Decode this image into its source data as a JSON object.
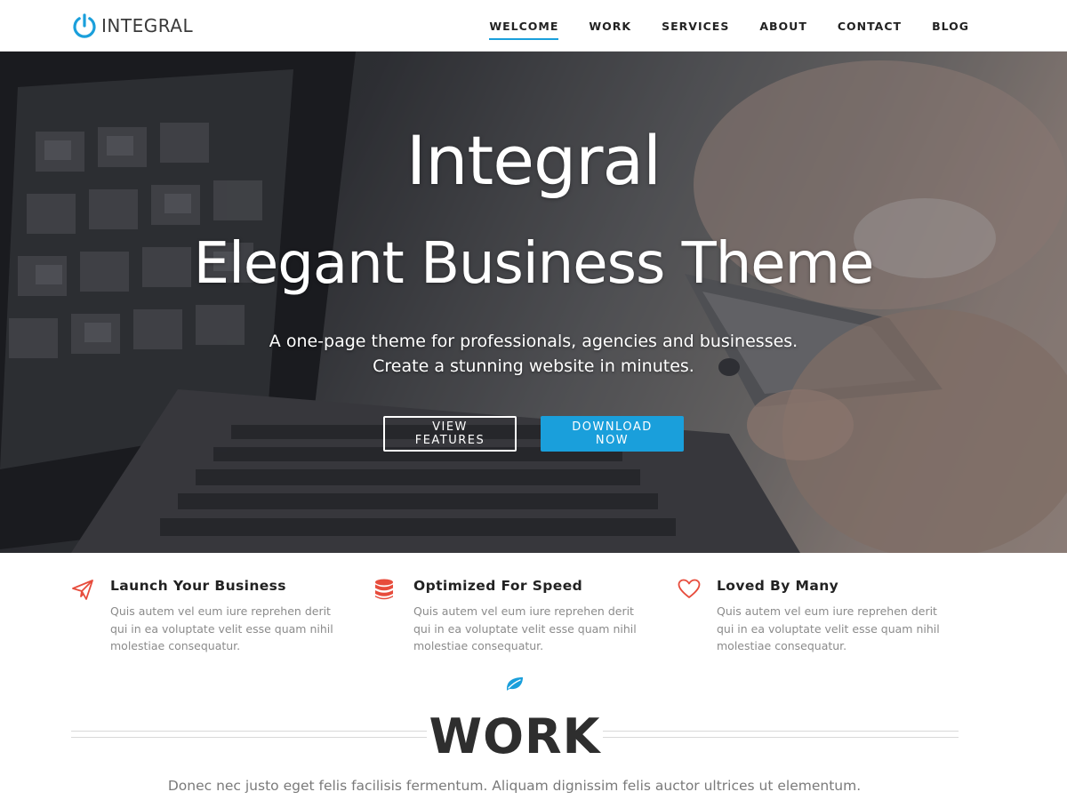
{
  "brand": {
    "name": "INTEGRAL",
    "accent_color": "#1a9fdb",
    "logo_icon": "power-icon"
  },
  "nav": {
    "items": [
      {
        "label": "WELCOME",
        "active": true
      },
      {
        "label": "WORK",
        "active": false
      },
      {
        "label": "SERVICES",
        "active": false
      },
      {
        "label": "ABOUT",
        "active": false
      },
      {
        "label": "CONTACT",
        "active": false
      },
      {
        "label": "BLOG",
        "active": false
      }
    ]
  },
  "hero": {
    "title_line1": "Integral",
    "title_line2": "Elegant Business Theme",
    "subtitle_line1": "A one-page theme for professionals, agencies and businesses.",
    "subtitle_line2": "Create a stunning website in minutes.",
    "button_secondary": "VIEW FEATURES",
    "button_primary": "DOWNLOAD NOW",
    "background_image": "laptop-and-phone-photo"
  },
  "features": [
    {
      "icon": "paper-plane-icon",
      "title": "Launch Your Business",
      "text": "Quis autem vel eum iure reprehen derit qui in ea voluptate velit esse quam nihil molestiae consequatur."
    },
    {
      "icon": "database-icon",
      "title": "Optimized For Speed",
      "text": "Quis autem vel eum iure reprehen derit qui in ea voluptate velit esse quam nihil molestiae consequatur."
    },
    {
      "icon": "heart-icon",
      "title": "Loved By Many",
      "text": "Quis autem vel eum iure reprehen derit qui in ea voluptate velit esse quam nihil molestiae consequatur."
    }
  ],
  "feature_icon_color": "#e74c3c",
  "work": {
    "icon": "leaf-icon",
    "title": "WORK",
    "subtitle": "Donec nec justo eget felis facilisis fermentum. Aliquam dignissim felis auctor ultrices ut elementum."
  }
}
